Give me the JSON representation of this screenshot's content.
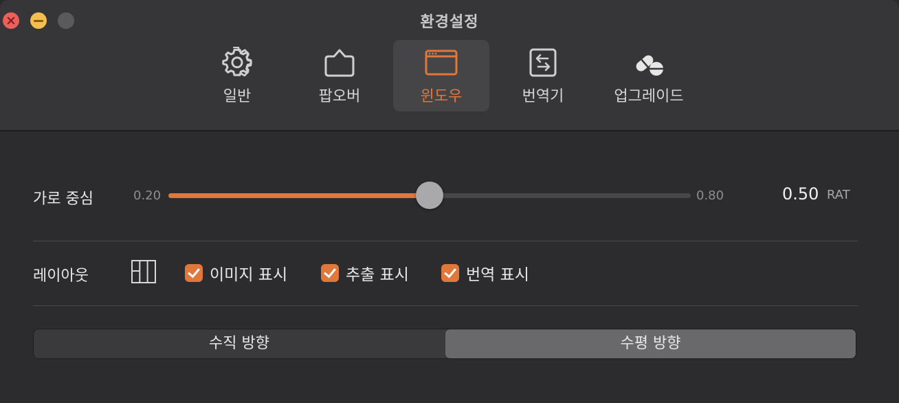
{
  "window": {
    "title": "환경설정"
  },
  "tabs": [
    {
      "label": "일반",
      "icon": "gear-icon"
    },
    {
      "label": "팝오버",
      "icon": "popover-bubble-icon"
    },
    {
      "label": "윈도우",
      "icon": "window-icon",
      "active": true
    },
    {
      "label": "번역기",
      "icon": "translator-swap-icon"
    },
    {
      "label": "업그레이드",
      "icon": "pill-upgrade-icon"
    }
  ],
  "horizontal_center": {
    "label": "가로 중심",
    "min_label": "0.20",
    "max_label": "0.80",
    "min": 0.2,
    "max": 0.8,
    "value": 0.5,
    "value_label": "0.50",
    "unit": "RAT"
  },
  "layout": {
    "label": "레이아웃",
    "icon": "columns-layout-icon",
    "options": [
      {
        "label": "이미지 표시",
        "checked": true
      },
      {
        "label": "추출 표시",
        "checked": true
      },
      {
        "label": "번역 표시",
        "checked": true
      }
    ]
  },
  "orientation": {
    "options": [
      "수직 방향",
      "수평 방향"
    ],
    "selected": "수평 방향"
  },
  "colors": {
    "accent": "#e0773b",
    "background": "#2c2c2e",
    "header": "#363638"
  }
}
